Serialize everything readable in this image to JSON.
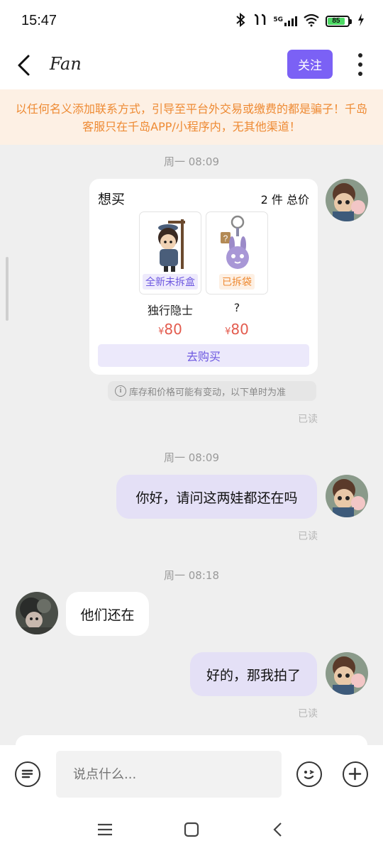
{
  "status": {
    "time": "15:47",
    "network": "5G",
    "battery": "85"
  },
  "header": {
    "title": "Fan",
    "follow_label": "关注"
  },
  "warning": {
    "text": "以任何名义添加联系方式，引导至平台外交易或缴费的都是骗子！千岛客服只在千岛APP/小程序内，无其他渠道！"
  },
  "messages": {
    "time1": "周一 08:09",
    "card": {
      "want_label": "想买",
      "count_label": "2 件 总价",
      "buy_label": "去购买",
      "items": [
        {
          "name": "独行隐士",
          "tag": "全新未拆盒",
          "currency": "¥",
          "price": "80"
        },
        {
          "name": "?",
          "tag": "已拆袋",
          "currency": "¥",
          "price": "80"
        }
      ]
    },
    "notice": "库存和价格可能有变动，以下单时为准",
    "read1": "已读",
    "time2": "周一 08:09",
    "msg1": "你好，请问这两娃都还在吗",
    "read2": "已读",
    "time3": "周一 08:18",
    "msg2": "他们还在",
    "msg3": "好的，那我拍了",
    "read3": "已读"
  },
  "composer": {
    "placeholder": "说点什么..."
  },
  "colors": {
    "accent": "#7b61f5",
    "warning_text": "#ee8a33",
    "price": "#e35b4e",
    "self_bubble": "#e4e0f6"
  }
}
